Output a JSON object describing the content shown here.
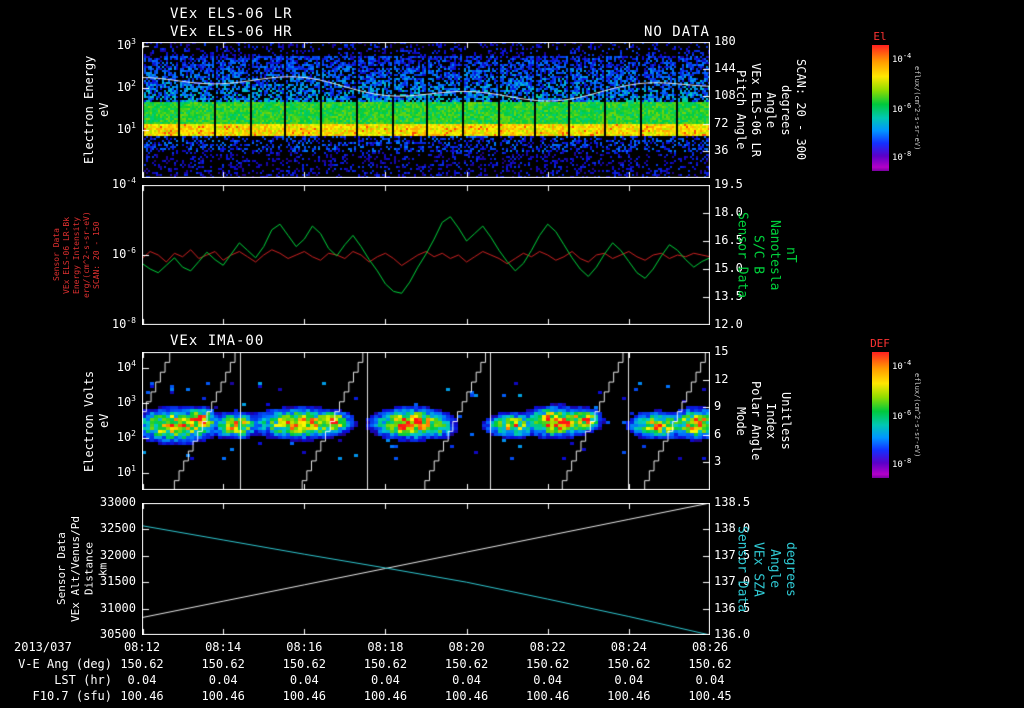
{
  "header": {
    "no_data_label": "NO DATA"
  },
  "colors": {
    "background": "#000000",
    "foreground": "#ffffff",
    "red_label": "#e03030",
    "green_label": "#00d23c",
    "cyan_label": "#2fc8d2",
    "colorbar_title": "#ff3333"
  },
  "time_axis": {
    "date_label": "2013/037",
    "ticks": [
      "08:12",
      "08:14",
      "08:16",
      "08:18",
      "08:20",
      "08:22",
      "08:24",
      "08:26"
    ]
  },
  "table": {
    "rows": [
      {
        "label": "V-E Ang (deg)",
        "values": [
          "150.62",
          "150.62",
          "150.62",
          "150.62",
          "150.62",
          "150.62",
          "150.62",
          "150.62"
        ]
      },
      {
        "label": "LST (hr)",
        "values": [
          "0.04",
          "0.04",
          "0.04",
          "0.04",
          "0.04",
          "0.04",
          "0.04",
          "0.04"
        ]
      },
      {
        "label": "F10.7 (sfu)",
        "values": [
          "100.46",
          "100.46",
          "100.46",
          "100.46",
          "100.46",
          "100.46",
          "100.46",
          "100.45"
        ]
      }
    ]
  },
  "colorbars": [
    {
      "title": "El",
      "tick_labels": [
        "10^-4",
        "10^-6",
        "10^-8"
      ],
      "units": "eflux/(cm^2-s-sr-eV)"
    },
    {
      "title": "DEF",
      "tick_labels": [
        "10^-4",
        "10^-6",
        "10^-8"
      ],
      "units": "eflux/(cm^2-s-sr-eV)"
    }
  ],
  "chart_data": [
    {
      "type": "heatmap",
      "title_lines": [
        "VEx ELS-06 LR",
        "VEx ELS-06 HR"
      ],
      "left_axis": {
        "label_lines": [
          "Electron Energy",
          "eV"
        ],
        "color": "#ffffff",
        "scale": "log",
        "tick_labels": [
          "10^3",
          "10^2",
          "10^1"
        ],
        "tick_values": [
          3,
          2,
          1
        ],
        "min": -0.15,
        "max": 3.1
      },
      "right_axis": {
        "label_lines": [
          "Pitch Angle",
          "VEx ELS-06 LR",
          "Angle",
          "degrees",
          "SCAN: 20 - 300"
        ],
        "color": "#ffffff",
        "tick_labels": [
          "180",
          "144",
          "108",
          "72",
          "36"
        ],
        "tick_values": [
          180,
          144,
          108,
          72,
          36
        ],
        "min": 0,
        "max": 180
      },
      "heatmap": {
        "description": "electron spectrogram: bright yellow band near 10 eV, green band 15-45 eV, blue speckle 45-560 eV, periodic vertical data gaps",
        "bands": [
          {
            "log_e": [
              0.85,
              1.15
            ],
            "level": 0.78,
            "fill": 1
          },
          {
            "log_e": [
              1.15,
              1.65
            ],
            "level": 0.55,
            "fill": 1
          },
          {
            "log_e": [
              1.65,
              2.75
            ],
            "level": 0.34,
            "level_top": 0.2,
            "fill": 0.62
          },
          {
            "log_e": [
              2.75,
              3.1
            ],
            "level": 0.16,
            "fill": 0.22
          },
          {
            "log_e": [
              0.45,
              0.85
            ],
            "level": 0.22,
            "fill": 0.4
          },
          {
            "log_e": [
              -0.15,
              0.45
            ],
            "level": 0.15,
            "fill": 0.25
          }
        ],
        "gap_count": 16,
        "overlay_line_log_e": 2.0
      }
    },
    {
      "type": "line",
      "left_axis": {
        "label_lines": [
          "Sensor Data",
          "VEx ELS-06 LR-Bk",
          "Energy Intensity",
          "erg/(cm^2-s-sr-eV)",
          "SCAN: 20 - 150"
        ],
        "color": "#e03030",
        "scale": "log",
        "tick_labels": [
          "10^-4",
          "10^-6",
          "10^-8"
        ],
        "tick_values": [
          -4,
          -6,
          -8
        ],
        "min": -8,
        "max": -4
      },
      "right_axis": {
        "label_lines": [
          "Sensor Data",
          "S/C B",
          "Nanotesla",
          "nT"
        ],
        "color": "#00d23c",
        "tick_labels": [
          "19.5",
          "18.0",
          "16.5",
          "15.0",
          "13.5",
          "12.0"
        ],
        "tick_values": [
          19.5,
          18,
          16.5,
          15,
          13.5,
          12
        ],
        "min": 12,
        "max": 19.5
      },
      "series": [
        {
          "name": "ELS-06 LR-Bk energy intensity (log10)",
          "axis": "left",
          "color": "#cc2222",
          "values": [
            -6.1,
            -5.9,
            -6.0,
            -6.2,
            -5.95,
            -6.05,
            -5.85,
            -6.1,
            -6.0,
            -5.9,
            -6.15,
            -6.0,
            -5.9,
            -6.05,
            -6.2,
            -6.0,
            -5.85,
            -5.95,
            -6.1,
            -6.0,
            -5.9,
            -6.05,
            -6.15,
            -5.95,
            -6.0,
            -6.1,
            -5.9,
            -6.0,
            -6.2,
            -6.05,
            -5.95,
            -6.1,
            -6.3,
            -6.15,
            -6.0,
            -5.9,
            -6.05,
            -5.95,
            -6.1,
            -6.0,
            -6.2,
            -6.05,
            -5.9,
            -6.0,
            -6.1,
            -6.25,
            -6.1,
            -5.95,
            -6.05,
            -5.9,
            -6.0,
            -6.15,
            -6.05,
            -5.9,
            -6.1,
            -6.2,
            -6.0,
            -5.95,
            -6.1,
            -6.0,
            -5.9,
            -6.05,
            -6.15,
            -6.0,
            -5.95,
            -6.1,
            -6.0,
            -6.05,
            -5.95,
            -6.0,
            -6.05
          ]
        },
        {
          "name": "S/C B field magnitude (nT)",
          "axis": "right",
          "color": "#00d23c",
          "values": [
            15.3,
            15.0,
            14.8,
            15.2,
            15.6,
            15.1,
            14.9,
            15.4,
            15.9,
            15.5,
            15.2,
            15.8,
            16.4,
            16.0,
            15.6,
            16.2,
            17.1,
            17.4,
            16.8,
            16.2,
            16.6,
            17.3,
            16.9,
            16.1,
            15.7,
            16.3,
            16.8,
            16.2,
            15.5,
            14.9,
            14.2,
            13.8,
            13.7,
            14.3,
            15.1,
            15.8,
            16.6,
            17.5,
            17.8,
            17.2,
            16.5,
            16.9,
            17.3,
            16.7,
            16.0,
            15.4,
            14.9,
            15.3,
            16.0,
            16.8,
            17.4,
            17.0,
            16.3,
            15.6,
            15.0,
            14.6,
            15.1,
            15.8,
            16.4,
            16.0,
            15.4,
            14.8,
            14.5,
            15.0,
            15.7,
            16.3,
            16.0,
            15.5,
            15.1,
            15.4,
            15.6
          ]
        }
      ]
    },
    {
      "type": "heatmap",
      "title": "VEx IMA-00",
      "left_axis": {
        "label_lines": [
          "Electron Volts",
          "eV"
        ],
        "color": "#ffffff",
        "scale": "log",
        "tick_labels": [
          "10^4",
          "10^3",
          "10^2",
          "10^1"
        ],
        "tick_values": [
          4,
          3,
          2,
          1
        ],
        "min": 0.5,
        "max": 4.45
      },
      "right_axis": {
        "label_lines": [
          "Mode",
          "Polar Angle",
          "Index",
          "Unitless"
        ],
        "color": "#ffffff",
        "tick_labels": [
          "15",
          "12",
          "9",
          "6",
          "3"
        ],
        "tick_values": [
          15,
          12,
          9,
          6,
          3
        ],
        "min": 0,
        "max": 15
      },
      "heatmap": {
        "description": "ion spectrogram: periodic ion blobs 100-600 eV with red/yellow cores, white elevation staircase lines and scan boundary lines",
        "blobs": [
          {
            "t": 0.06,
            "e": 2.35,
            "st": 0.045,
            "se": 0.28,
            "a": 0.85
          },
          {
            "t": 0.1,
            "e": 2.5,
            "st": 0.02,
            "se": 0.2,
            "a": 0.95
          },
          {
            "t": 0.165,
            "e": 2.35,
            "st": 0.025,
            "se": 0.22,
            "a": 0.8
          },
          {
            "t": 0.28,
            "e": 2.4,
            "st": 0.05,
            "se": 0.25,
            "a": 0.85
          },
          {
            "t": 0.335,
            "e": 2.45,
            "st": 0.02,
            "se": 0.18,
            "a": 0.9
          },
          {
            "t": 0.475,
            "e": 2.4,
            "st": 0.04,
            "se": 0.25,
            "a": 0.95
          },
          {
            "t": 0.52,
            "e": 2.3,
            "st": 0.02,
            "se": 0.2,
            "a": 0.6
          },
          {
            "t": 0.655,
            "e": 2.35,
            "st": 0.03,
            "se": 0.2,
            "a": 0.75
          },
          {
            "t": 0.73,
            "e": 2.45,
            "st": 0.035,
            "se": 0.25,
            "a": 0.95
          },
          {
            "t": 0.775,
            "e": 2.5,
            "st": 0.02,
            "se": 0.2,
            "a": 0.85
          },
          {
            "t": 0.91,
            "e": 2.35,
            "st": 0.03,
            "se": 0.22,
            "a": 0.8
          },
          {
            "t": 0.975,
            "e": 2.4,
            "st": 0.025,
            "se": 0.25,
            "a": 0.9
          }
        ],
        "vlines": [
          0.172,
          0.397,
          0.613,
          0.855
        ],
        "stair_ends": [
          0.057,
          0.172,
          0.397,
          0.613,
          0.855,
          1.0
        ],
        "staircase": {
          "steps": 14,
          "span": 0.115
        }
      }
    },
    {
      "type": "line",
      "left_axis": {
        "label_lines": [
          "Sensor Data",
          "VEx Alt/Venus/Pd",
          "Distance",
          "km"
        ],
        "color": "#ffffff",
        "tick_labels": [
          "33000",
          "32500",
          "32000",
          "31500",
          "31000",
          "30500"
        ],
        "tick_values": [
          33000,
          32500,
          32000,
          31500,
          31000,
          30500
        ],
        "min": 30500,
        "max": 33000
      },
      "right_axis": {
        "label_lines": [
          "Sensor Data",
          "VEx SZA",
          "Angle",
          "degrees"
        ],
        "color": "#2fc8d2",
        "tick_labels": [
          "138.5",
          "138.0",
          "137.5",
          "137.0",
          "136.5",
          "136.0"
        ],
        "tick_values": [
          138.5,
          138,
          137.5,
          137,
          136.5,
          136
        ],
        "min": 136,
        "max": 138.5
      },
      "series": [
        {
          "name": "VEx altitude above Venus (km)",
          "axis": "left",
          "color": "#e8e8e8",
          "values": [
            30830,
            31140,
            31450,
            31760,
            32070,
            32380,
            32690,
            33000
          ]
        },
        {
          "name": "VEx solar zenith angle (deg)",
          "axis": "right",
          "color": "#2fc8d2",
          "values": [
            138.07,
            137.8,
            137.53,
            137.27,
            137.0,
            136.68,
            136.35,
            136.0
          ]
        }
      ]
    }
  ]
}
